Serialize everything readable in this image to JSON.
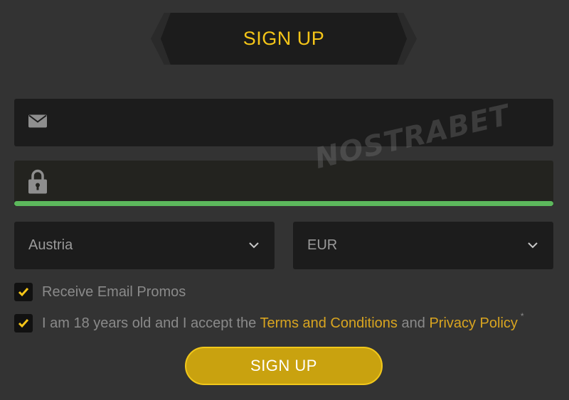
{
  "header": {
    "title": "SIGN UP"
  },
  "form": {
    "email": {
      "icon": "envelope-icon",
      "value": ""
    },
    "password": {
      "icon": "lock-icon",
      "value": "",
      "strength_color": "#5cb85c"
    },
    "country": {
      "value": "Austria"
    },
    "currency": {
      "value": "EUR"
    },
    "promos": {
      "label": "Receive Email Promos",
      "checked": true
    },
    "terms": {
      "prefix": "I am 18 years old and I accept the",
      "terms_link": "Terms and Conditions",
      "and": "and",
      "privacy_link": "Privacy Policy",
      "asterisk": "*",
      "checked": true
    },
    "submit_label": "SIGN UP"
  },
  "watermark": "NOSTRABET",
  "colors": {
    "accent": "#f5c518",
    "button": "#c9a20f",
    "background": "#333333"
  }
}
